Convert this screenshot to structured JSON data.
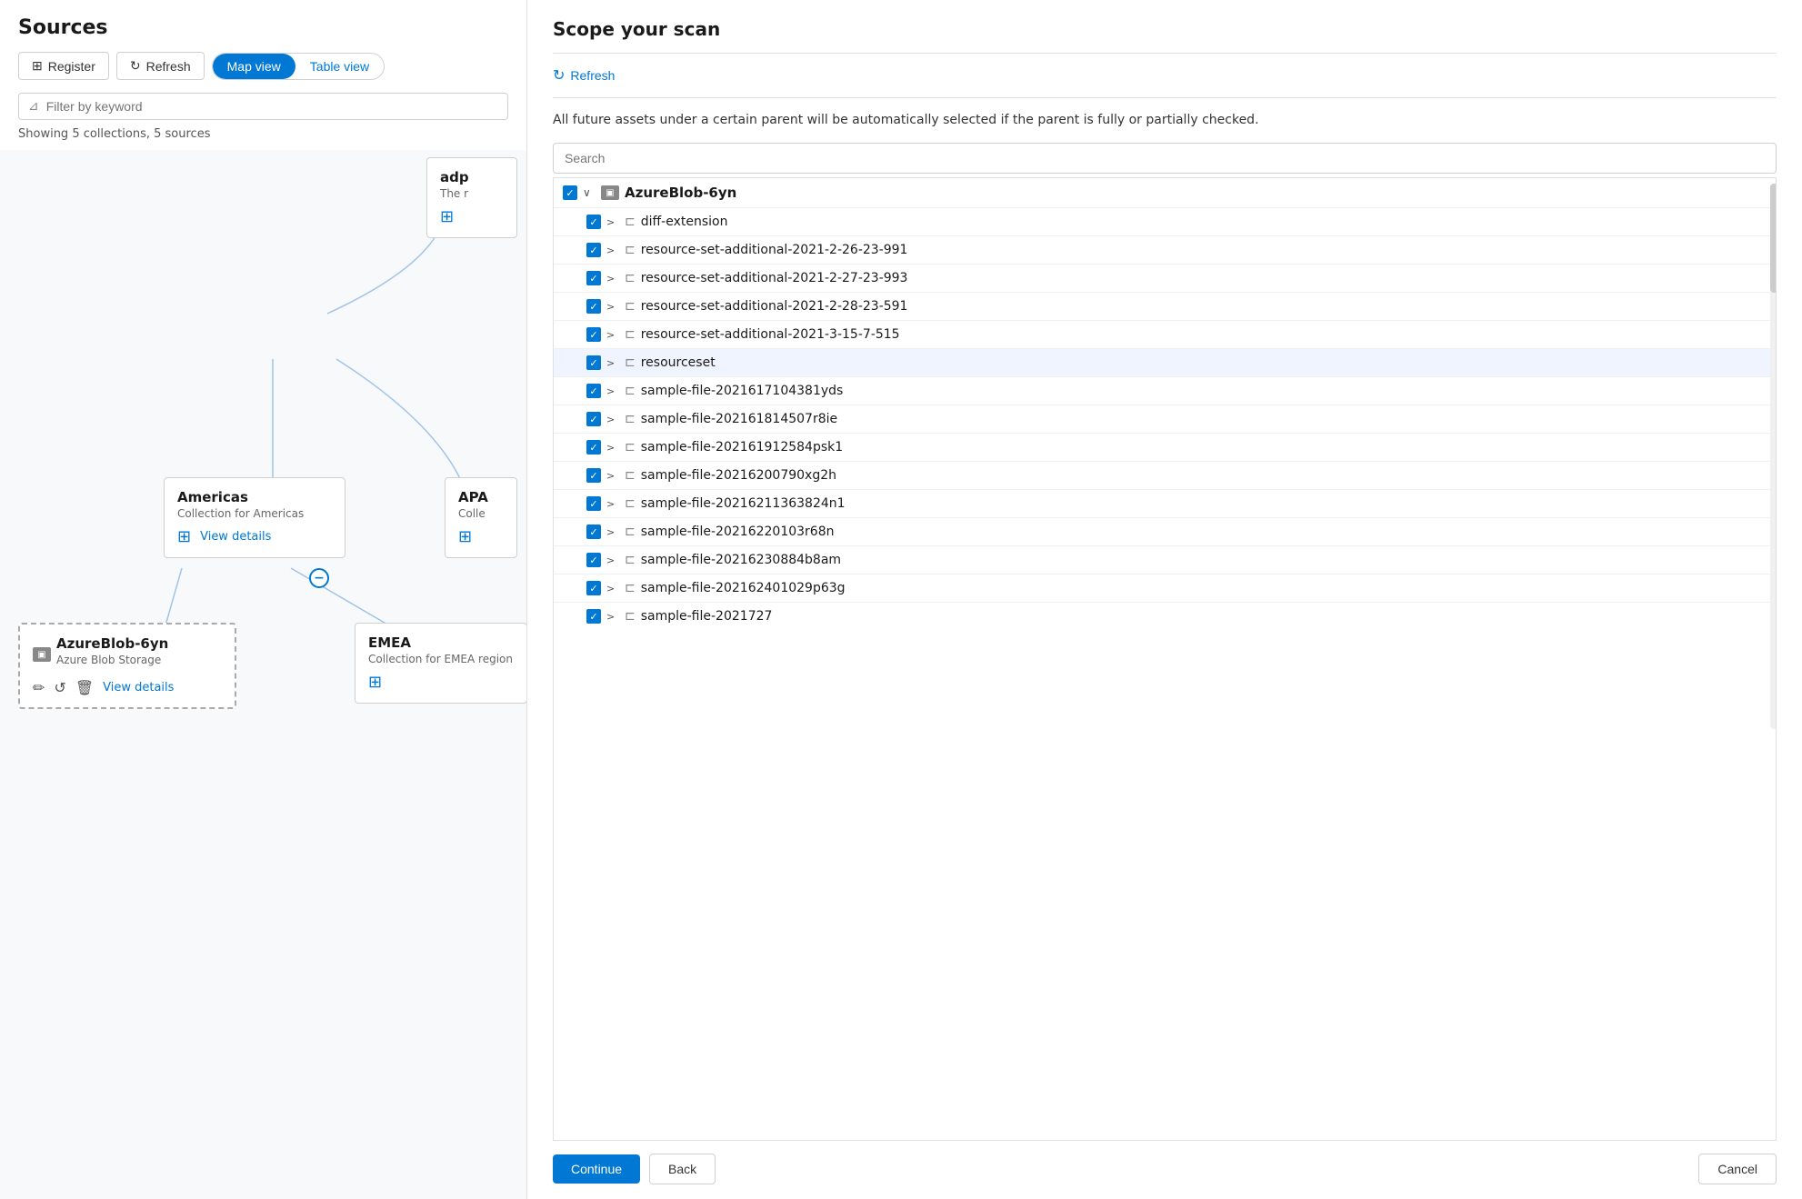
{
  "left": {
    "title": "Sources",
    "toolbar": {
      "register_label": "Register",
      "refresh_label": "Refresh",
      "map_view_label": "Map view",
      "table_view_label": "Table view"
    },
    "filter_placeholder": "Filter by keyword",
    "showing_text": "Showing 5 collections, 5 sources",
    "nodes": {
      "adp": {
        "title": "adp",
        "subtitle": "The r"
      },
      "americas": {
        "title": "Americas",
        "subtitle": "Collection for Americas",
        "view_details": "View details"
      },
      "apa": {
        "title": "APA",
        "subtitle": "Colle"
      },
      "azure_blob": {
        "title": "AzureBlob-6yn",
        "subtitle": "Azure Blob Storage",
        "view_details": "View details"
      },
      "emea": {
        "title": "EMEA",
        "subtitle": "Collection for EMEA region"
      }
    }
  },
  "right": {
    "title": "Scope your scan",
    "refresh_label": "Refresh",
    "info_text": "All future assets under a certain parent will be automatically selected if the parent is fully or partially checked.",
    "search_placeholder": "Search",
    "tree": {
      "root": {
        "label": "AzureBlob-6yn",
        "checked": true
      },
      "items": [
        {
          "label": "diff-extension",
          "checked": true,
          "indent": 1
        },
        {
          "label": "resource-set-additional-2021-2-26-23-991",
          "checked": true,
          "indent": 1
        },
        {
          "label": "resource-set-additional-2021-2-27-23-993",
          "checked": true,
          "indent": 1
        },
        {
          "label": "resource-set-additional-2021-2-28-23-591",
          "checked": true,
          "indent": 1
        },
        {
          "label": "resource-set-additional-2021-3-15-7-515",
          "checked": true,
          "indent": 1
        },
        {
          "label": "resourceset",
          "checked": true,
          "indent": 1,
          "highlighted": true
        },
        {
          "label": "sample-file-2021617104381yds",
          "checked": true,
          "indent": 1
        },
        {
          "label": "sample-file-202161814507r8ie",
          "checked": true,
          "indent": 1
        },
        {
          "label": "sample-file-202161912584psk1",
          "checked": true,
          "indent": 1
        },
        {
          "label": "sample-file-20216200790xg2h",
          "checked": true,
          "indent": 1
        },
        {
          "label": "sample-file-20216211363824n1",
          "checked": true,
          "indent": 1
        },
        {
          "label": "sample-file-20216220103r68n",
          "checked": true,
          "indent": 1
        },
        {
          "label": "sample-file-20216230884b8am",
          "checked": true,
          "indent": 1
        },
        {
          "label": "sample-file-202162401029p63g",
          "checked": true,
          "indent": 1
        },
        {
          "label": "sample-file-2021727",
          "checked": true,
          "indent": 1
        }
      ]
    },
    "footer": {
      "continue_label": "Continue",
      "back_label": "Back",
      "cancel_label": "Cancel"
    }
  }
}
